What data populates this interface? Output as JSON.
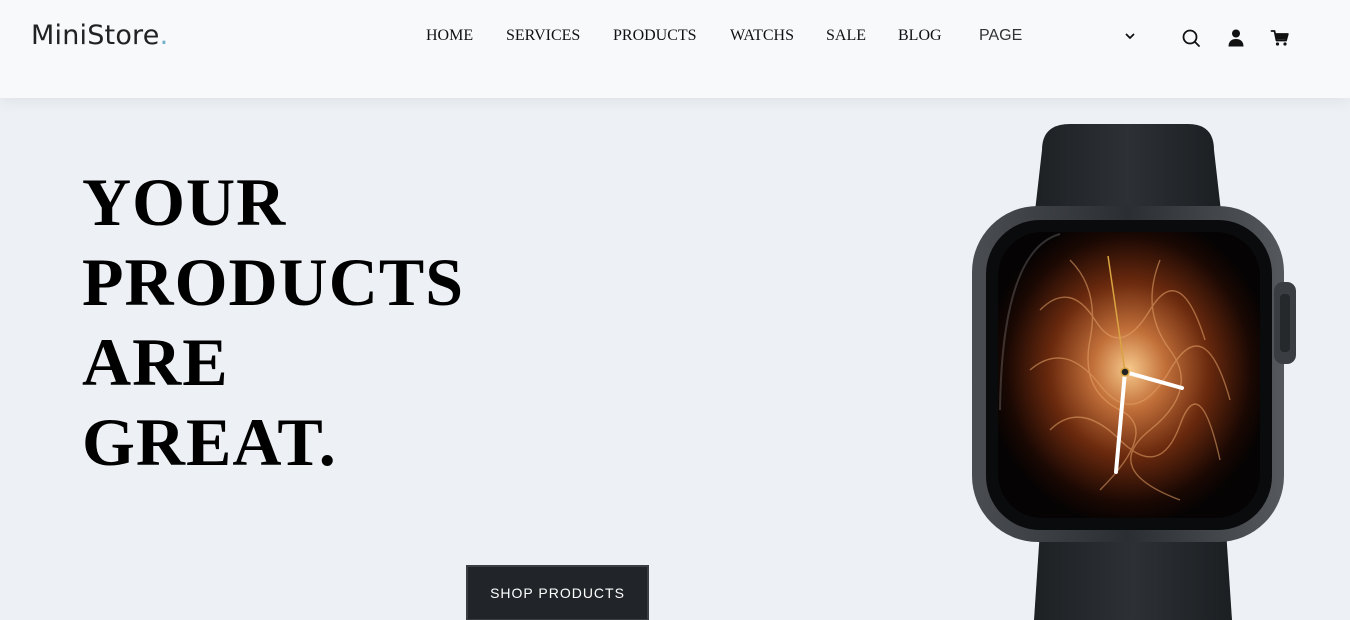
{
  "header": {
    "logo_text": "MiniStore",
    "logo_dot": ".",
    "nav": [
      {
        "label": "HOME"
      },
      {
        "label": "SERVICES"
      },
      {
        "label": "PRODUCTS"
      },
      {
        "label": "WATCHS"
      },
      {
        "label": "SALE"
      },
      {
        "label": "BLOG"
      },
      {
        "label": "PAGE"
      }
    ],
    "icons": [
      "chevron-down-icon",
      "search-icon",
      "user-icon",
      "cart-icon"
    ]
  },
  "hero": {
    "title_lines": [
      "YOUR",
      "PRODUCTS",
      "ARE",
      "GREAT."
    ],
    "button_label": "SHOP PRODUCTS"
  },
  "colors": {
    "background": "#edf1f5",
    "header_bg": "#f8f9fb",
    "logo_accent": "#72aec8",
    "button_bg": "#212529"
  }
}
